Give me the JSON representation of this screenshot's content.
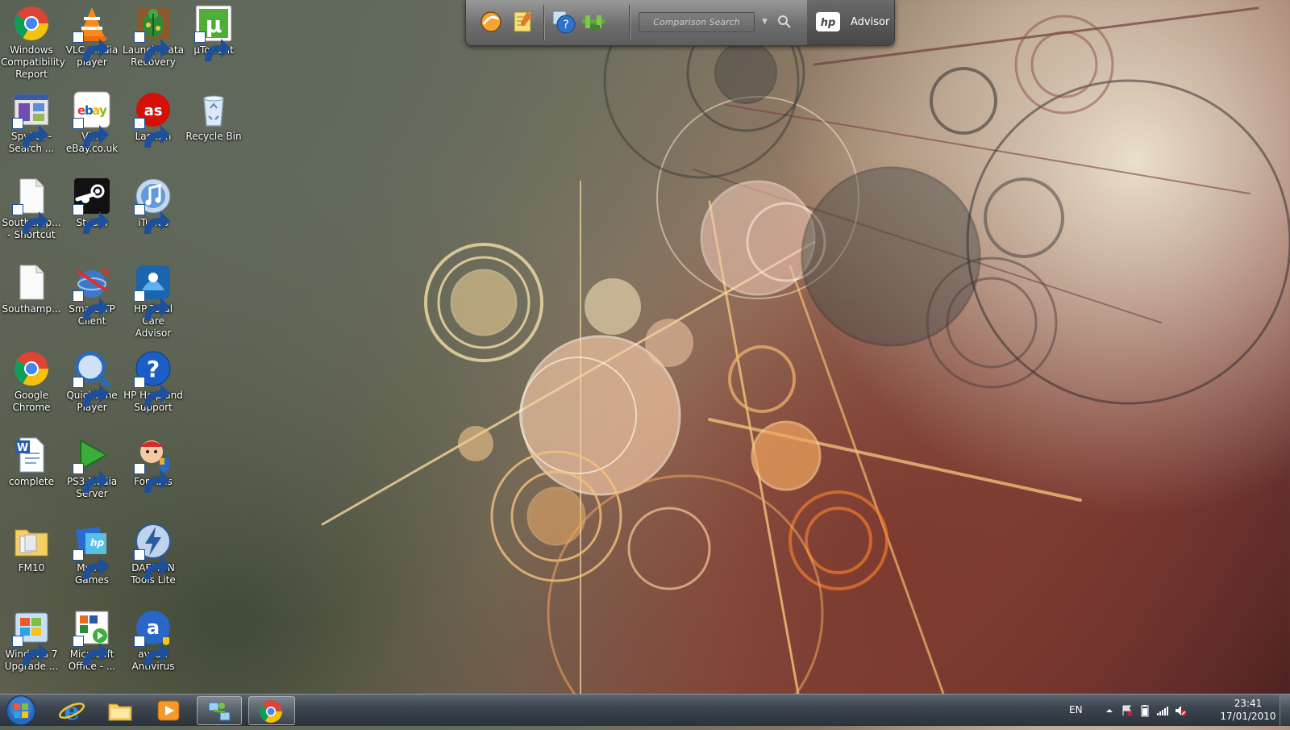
{
  "desktop": {
    "icons": [
      {
        "label": "Windows Compatibility Report",
        "icon": "chrome-icon"
      },
      {
        "label": "VLC media player",
        "icon": "vlc-icon"
      },
      {
        "label": "Launch Data Recovery",
        "icon": "data-recovery-icon"
      },
      {
        "label": "µTorrent",
        "icon": "utorrent-icon"
      },
      {
        "label": "Spybot - Search ...",
        "icon": "spybot-icon"
      },
      {
        "label": "Visit eBay.co.uk",
        "icon": "ebay-icon"
      },
      {
        "label": "Last.fm",
        "icon": "lastfm-icon"
      },
      {
        "label": "Recycle Bin",
        "icon": "recycle-bin-icon"
      },
      {
        "label": "Southamp... - Shortcut",
        "icon": "document-icon"
      },
      {
        "label": "Steam",
        "icon": "steam-icon"
      },
      {
        "label": "iTunes",
        "icon": "itunes-icon"
      },
      {
        "label": "Southamp...",
        "icon": "document-icon"
      },
      {
        "label": "SmartFTP Client",
        "icon": "smartftp-icon"
      },
      {
        "label": "HP Total Care Advisor",
        "icon": "hp-advisor-icon"
      },
      {
        "label": "Google Chrome",
        "icon": "chrome-icon"
      },
      {
        "label": "QuickTime Player",
        "icon": "quicktime-icon"
      },
      {
        "label": "HP Help and Support",
        "icon": "help-icon"
      },
      {
        "label": "complete",
        "icon": "word-document-icon"
      },
      {
        "label": "PS3 Media Server",
        "icon": "ps3-media-icon"
      },
      {
        "label": "For Kids",
        "icon": "for-kids-icon"
      },
      {
        "label": "FM10",
        "icon": "folder-icon"
      },
      {
        "label": "My HP Games",
        "icon": "hp-games-icon"
      },
      {
        "label": "DAEMON Tools Lite",
        "icon": "daemon-tools-icon"
      },
      {
        "label": "Windows 7 Upgrade ...",
        "icon": "windows-upgrade-icon"
      },
      {
        "label": "Microsoft Office - ...",
        "icon": "office-icon"
      },
      {
        "label": "avast! Antivirus",
        "icon": "avast-icon"
      }
    ]
  },
  "gadget": {
    "search_placeholder": "Comparison Search",
    "brand": "Advisor",
    "buttons": [
      "weather-icon",
      "notes-icon",
      "help-icon",
      "network-icon"
    ]
  },
  "taskbar": {
    "pinned": [
      "internet-explorer-icon",
      "folder-icon",
      "media-player-icon",
      "network-icon",
      "chrome-icon"
    ],
    "language": "EN",
    "time": "23:41",
    "date": "17/01/2010"
  }
}
